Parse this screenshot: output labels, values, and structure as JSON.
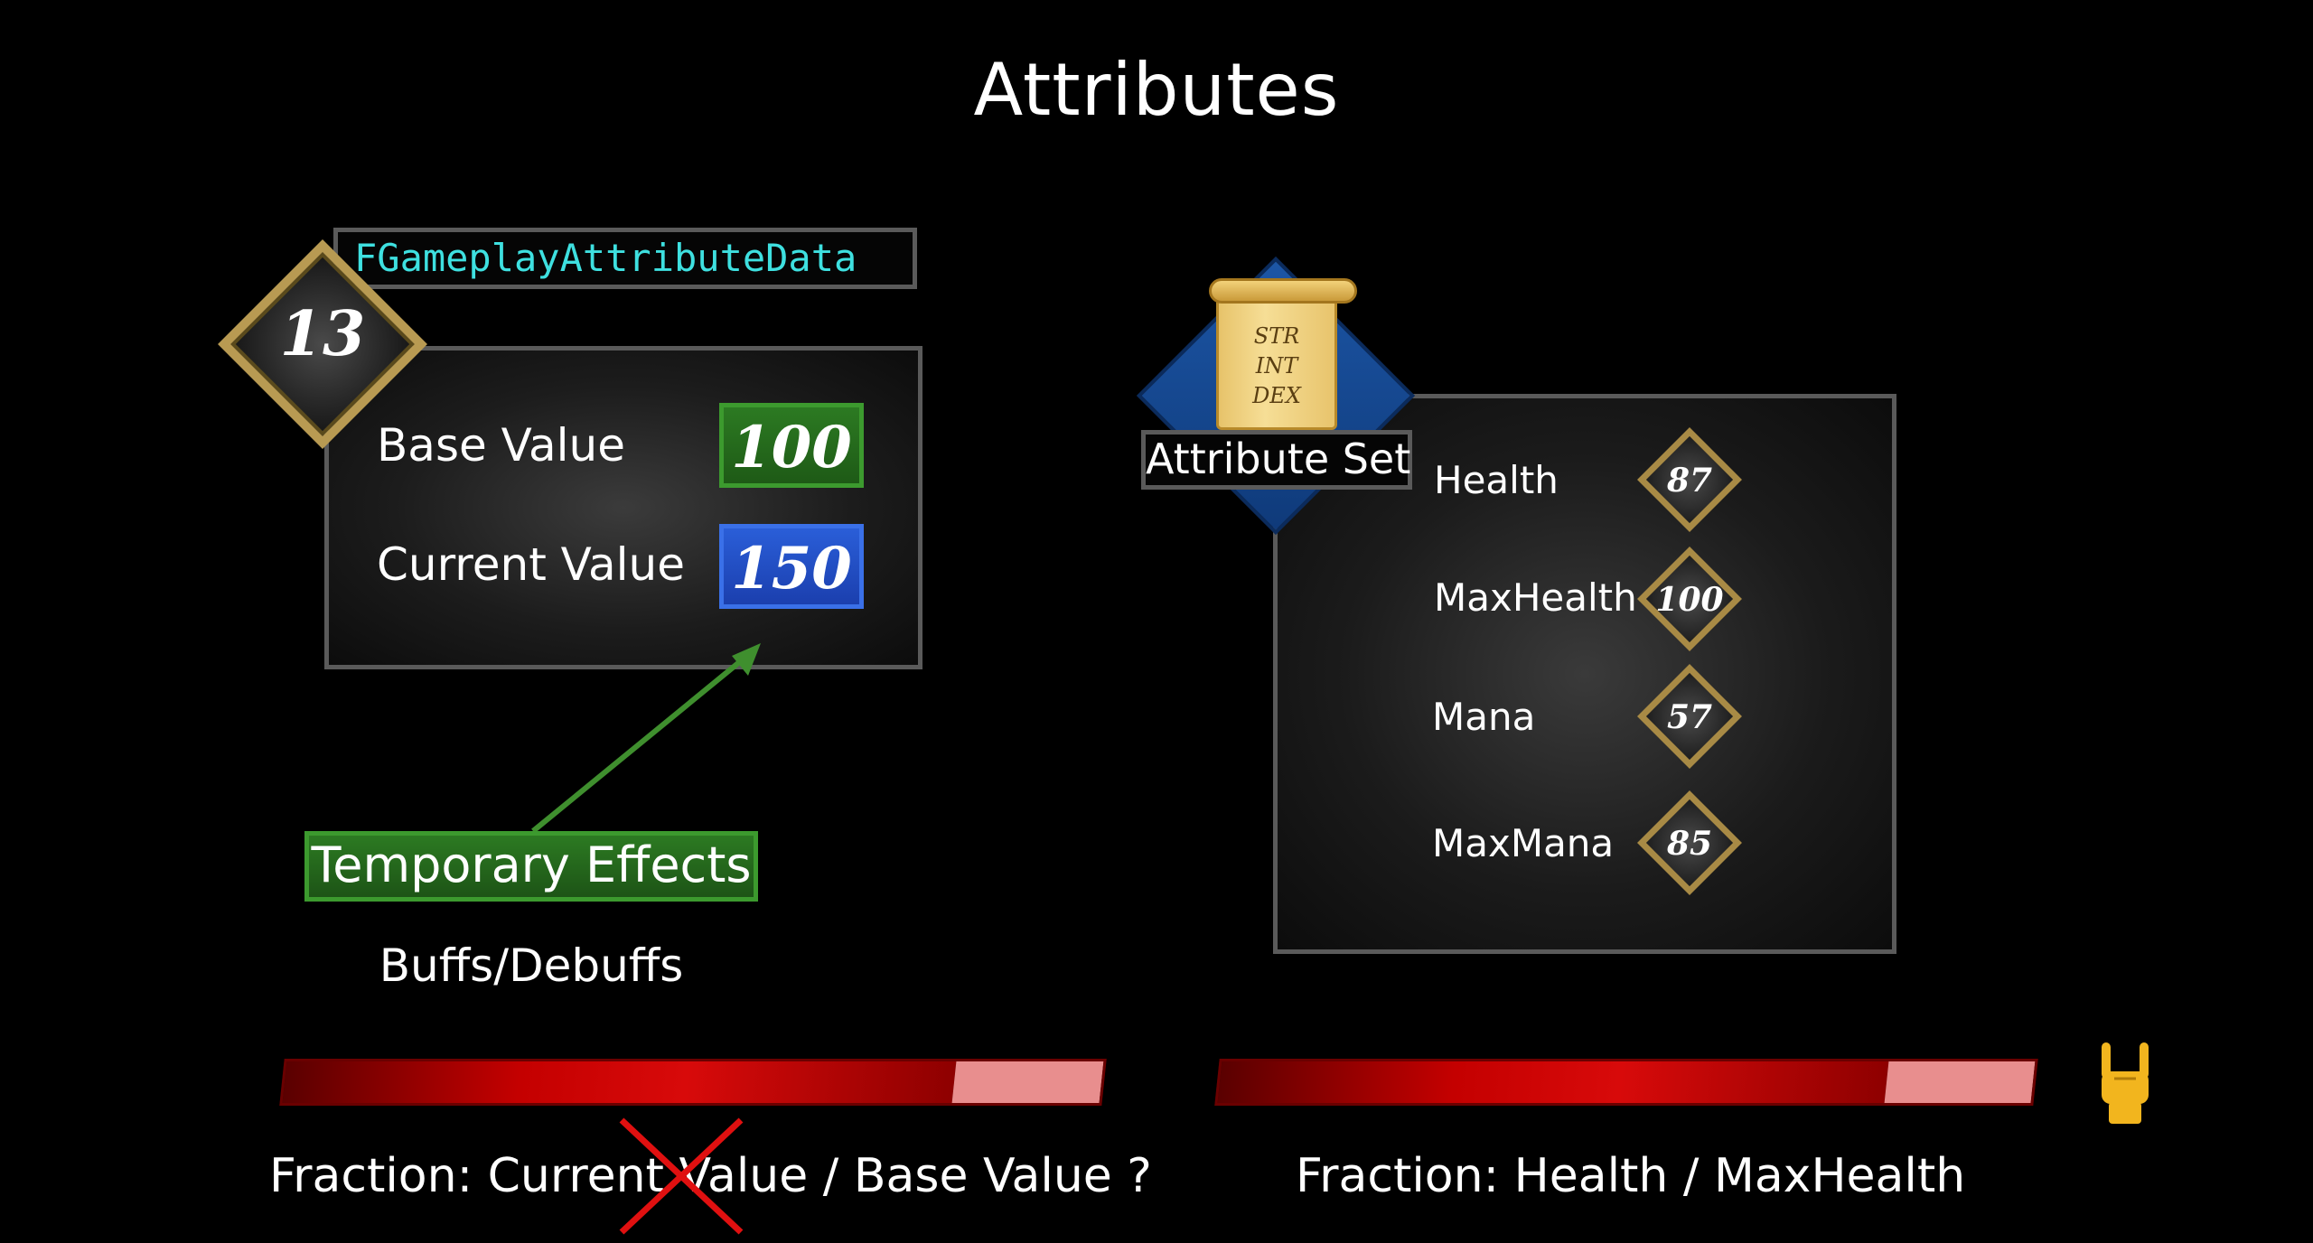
{
  "title": "Attributes",
  "left": {
    "struct_name": "FGameplayAttributeData",
    "level": "13",
    "base_value_label": "Base Value",
    "base_value": "100",
    "current_value_label": "Current Value",
    "current_value": "150",
    "temporary_effects": "Temporary Effects",
    "buffs_label": "Buffs/Debuffs",
    "bar_fraction": 0.82,
    "caption_prefix": "Fraction: Current ",
    "caption_struck": "Value",
    "caption_suffix": " / Base Value ?"
  },
  "right": {
    "scroll_lines": [
      "STR",
      "INT",
      "DEX"
    ],
    "attribute_set_label": "Attribute Set",
    "attributes": [
      {
        "name": "Health",
        "value": "87"
      },
      {
        "name": "MaxHealth",
        "value": "100"
      },
      {
        "name": "Mana",
        "value": "57"
      },
      {
        "name": "MaxMana",
        "value": "85"
      }
    ],
    "bar_fraction": 0.82,
    "caption": "Fraction: Health / MaxHealth"
  },
  "colors": {
    "accent_cyan": "#3ee0e0",
    "green": "#2c7a22",
    "blue": "#1b3fae",
    "gold": "#b89a52",
    "bar_red": "#c40000",
    "strike_red": "#e01010"
  },
  "icons": [
    "arrow-up-right-icon",
    "cross-out-icon",
    "rock-on-hand-icon",
    "scroll-icon"
  ]
}
